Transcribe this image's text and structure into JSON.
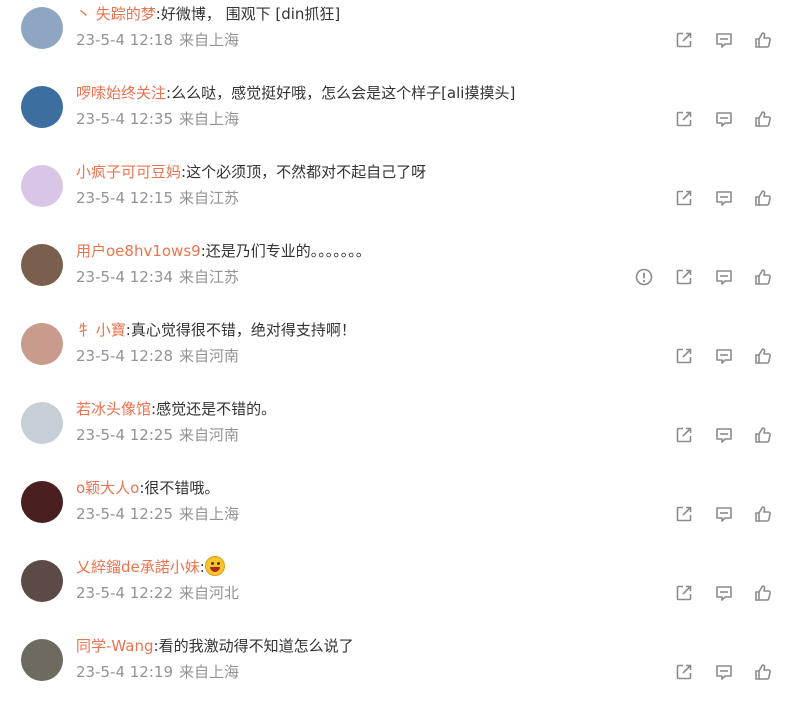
{
  "colors": {
    "username": "#eb7350",
    "text": "#333333",
    "meta": "#939393",
    "icon": "#8c8c8c"
  },
  "comments": [
    {
      "user": "丶 失踪的梦",
      "text": ":好微博， 围观下 [din抓狂]",
      "time": "23-5-4 12:18",
      "location": "来自上海",
      "avatar_color": "#8ea6c4",
      "has_report": false,
      "has_emoji": false
    },
    {
      "user": "啰嗦始终关注",
      "text": ":么么哒，感觉挺好哦，怎么会是这个样子[ali摸摸头]",
      "time": "23-5-4 12:35",
      "location": "来自上海",
      "avatar_color": "#3c6fa0",
      "has_report": false,
      "has_emoji": false
    },
    {
      "user": "小疯子可可豆妈",
      "text": ":这个必须顶，不然都对不起自己了呀",
      "time": "23-5-4 12:15",
      "location": "来自江苏",
      "avatar_color": "#d9c6e6",
      "has_report": false,
      "has_emoji": false
    },
    {
      "user": "用户oe8hv1ows9",
      "text": ":还是乃们专业的。。。。。。。",
      "time": "23-5-4 12:34",
      "location": "来自江苏",
      "avatar_color": "#7a5f4e",
      "has_report": true,
      "has_emoji": false
    },
    {
      "user": "牜 小寶",
      "text": ":真心觉得很不错，绝对得支持啊！",
      "time": "23-5-4 12:28",
      "location": "来自河南",
      "avatar_color": "#c99b8c",
      "has_report": false,
      "has_emoji": false
    },
    {
      "user": "若冰头像馆",
      "text": ":感觉还是不错的。",
      "time": "23-5-4 12:25",
      "location": "来自河南",
      "avatar_color": "#c7cfd6",
      "has_report": false,
      "has_emoji": false
    },
    {
      "user": "o颖大人o",
      "text": ":很不错哦。",
      "time": "23-5-4 12:25",
      "location": "来自上海",
      "avatar_color": "#4a1f1f",
      "has_report": false,
      "has_emoji": false
    },
    {
      "user": "乂綷鎦de承諾小妹",
      "text": ":",
      "time": "23-5-4 12:22",
      "location": "来自河北",
      "avatar_color": "#5b4a45",
      "has_report": false,
      "has_emoji": true
    },
    {
      "user": "同学-Wang",
      "text": ":看的我激动得不知道怎么说了",
      "time": "23-5-4 12:19",
      "location": "来自上海",
      "avatar_color": "#6e6a5f",
      "has_report": false,
      "has_emoji": false
    }
  ],
  "icons": {
    "report": "report-icon",
    "forward": "forward-icon",
    "reply": "comment-icon",
    "like": "like-icon",
    "emoji": "laughing-emoji"
  }
}
